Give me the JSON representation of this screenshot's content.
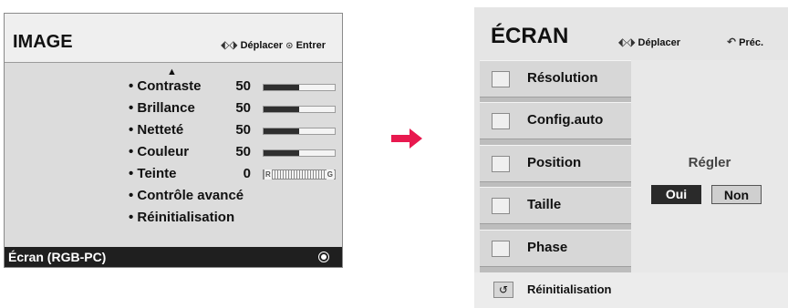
{
  "image_menu": {
    "title": "IMAGE",
    "hint_move": "Déplacer",
    "hint_enter": "Entrer",
    "items": [
      {
        "label": "• Contraste",
        "value": "50",
        "level": 0.5
      },
      {
        "label": "• Brillance",
        "value": "50",
        "level": 0.5
      },
      {
        "label": "• Netteté",
        "value": "50",
        "level": 0.5
      },
      {
        "label": "• Couleur",
        "value": "50",
        "level": 0.5
      },
      {
        "label": "• Teinte",
        "value": "0",
        "tint_left": "R",
        "tint_right": "G"
      },
      {
        "label": "• Contrôle avancé"
      },
      {
        "label": "• Réinitialisation"
      }
    ],
    "selected": "Écran (RGB-PC)"
  },
  "screen_menu": {
    "title": "ÉCRAN",
    "hint_move": "Déplacer",
    "hint_back": "Préc.",
    "items": [
      {
        "label": "Résolution",
        "icon": "resolution-icon"
      },
      {
        "label": "Config.auto",
        "icon": "auto-config-icon"
      },
      {
        "label": "Position",
        "icon": "position-icon"
      },
      {
        "label": "Taille",
        "icon": "size-icon"
      },
      {
        "label": "Phase",
        "icon": "phase-icon"
      }
    ],
    "prompt": "Régler",
    "yes_label": "Oui",
    "no_label": "Non",
    "reset_label": "Réinitialisation"
  },
  "colors": {
    "accent_arrow": "#e8194f",
    "bar_fill": "#2f2f2f",
    "selected_bg": "#1f1f1f"
  }
}
